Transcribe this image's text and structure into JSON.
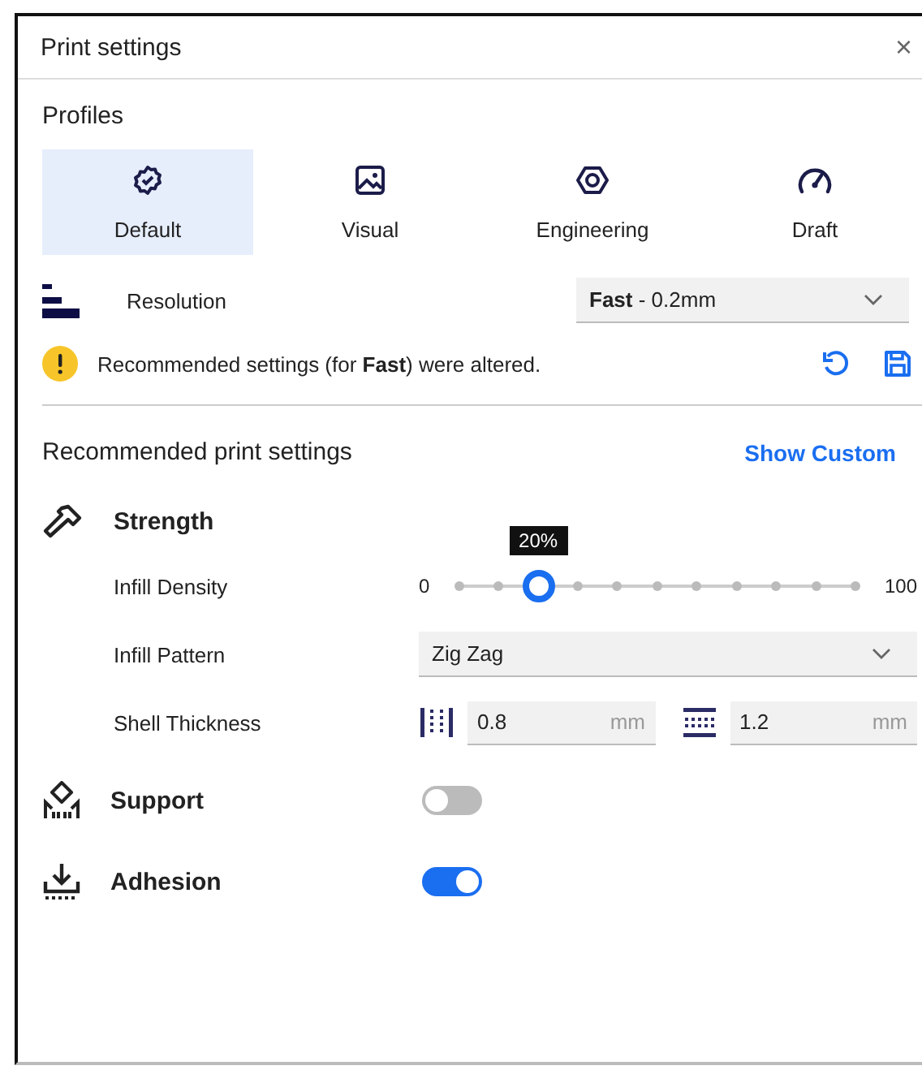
{
  "window": {
    "title": "Print settings",
    "close": "×"
  },
  "profiles": {
    "label": "Profiles",
    "items": [
      {
        "label": "Default",
        "kind": "gear",
        "selected": true
      },
      {
        "label": "Visual",
        "kind": "image",
        "selected": false
      },
      {
        "label": "Engineering",
        "kind": "nut",
        "selected": false
      },
      {
        "label": "Draft",
        "kind": "gauge",
        "selected": false
      }
    ]
  },
  "resolution": {
    "label": "Resolution",
    "value": "**Fast** - 0.2mm"
  },
  "warning": {
    "text": "Recommended settings (for **Fast**) were altered."
  },
  "recommended": {
    "title": "Recommended print settings",
    "link": "Show Custom"
  },
  "strength": {
    "title": "Strength",
    "infill_density": {
      "label": "Infill Density",
      "min": "0",
      "max": "100",
      "tooltip": "20%",
      "level": 0.2
    },
    "infill_pattern": {
      "label": "Infill Pattern",
      "value": "Zig Zag"
    },
    "shell_thickness": {
      "label": "Shell Thickness",
      "wall": {
        "value": "0.8",
        "unit": "mm"
      },
      "top_bottom": {
        "value": "1.2",
        "unit": "mm"
      }
    }
  },
  "toggles": [
    {
      "label": "Support",
      "kind": "support",
      "on": false
    },
    {
      "label": "Adhesion",
      "kind": "adhesion",
      "on": true
    }
  ]
}
